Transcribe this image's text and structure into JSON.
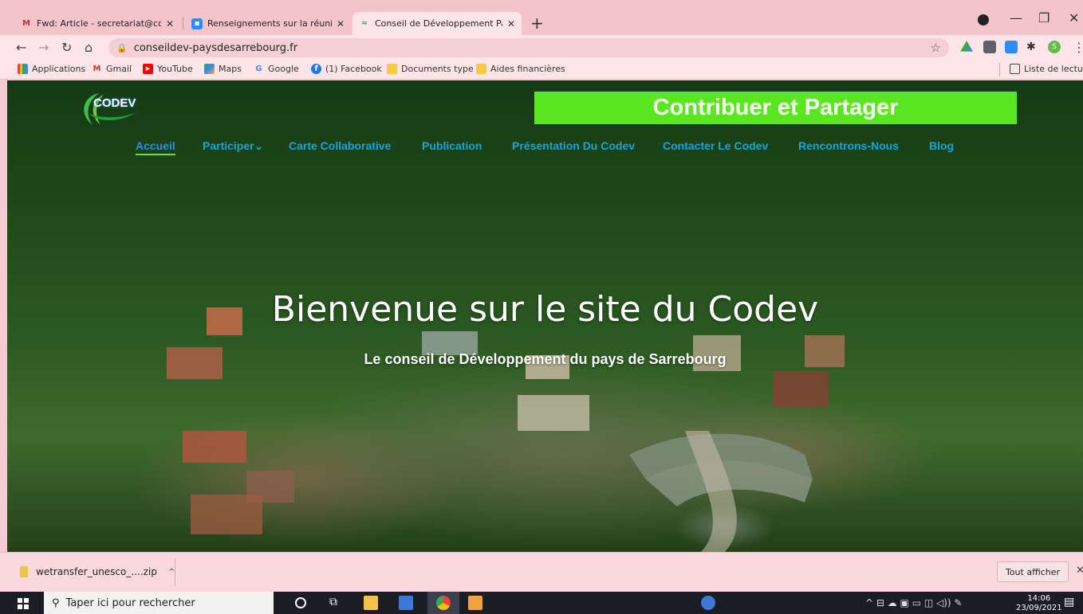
{
  "tabs": [
    {
      "title": "Fwd: Article - secretariat@consei",
      "close": "✕",
      "favicon": "gmail-icon",
      "active": false
    },
    {
      "title": "Renseignements sur la réunion -",
      "close": "✕",
      "favicon": "zoom-icon",
      "active": false
    },
    {
      "title": "Conseil de Développement Pays",
      "close": "✕",
      "favicon": "codev-icon",
      "active": true
    }
  ],
  "newtab_label": "+",
  "window_controls": {
    "minimize": "—",
    "maximize": "❐",
    "close": "✕"
  },
  "address": {
    "url": "conseildev-paysdesarrebourg.fr"
  },
  "bookmarks": [
    {
      "label": "Applications",
      "icon": "apps-grid-icon"
    },
    {
      "label": "Gmail",
      "icon": "gmail-icon"
    },
    {
      "label": "YouTube",
      "icon": "youtube-icon"
    },
    {
      "label": "Maps",
      "icon": "maps-icon"
    },
    {
      "label": "Google",
      "icon": "google-icon"
    },
    {
      "label": "(1) Facebook",
      "icon": "facebook-icon"
    },
    {
      "label": "Documents type",
      "icon": "folder-icon"
    },
    {
      "label": "Aides financières",
      "icon": "folder-icon"
    }
  ],
  "reading_list": "Liste de lecture",
  "site": {
    "logo_text": "CODEV",
    "cta": "Contribuer et Partager",
    "nav": [
      {
        "label": "Accueil",
        "active": true
      },
      {
        "label": "Participer",
        "dropdown": "⌄"
      },
      {
        "label": "Carte Collaborative"
      },
      {
        "label": "Publication"
      },
      {
        "label": "Présentation Du Codev"
      },
      {
        "label": "Contacter Le Codev"
      },
      {
        "label": "Rencontrons-Nous"
      },
      {
        "label": "Blog"
      }
    ],
    "hero_title": "Bienvenue sur le site du Codev",
    "hero_subtitle": "Le conseil de Développement du pays de Sarrebourg"
  },
  "download": {
    "filename": "wetransfer_unesco_....zip",
    "chevron": "^",
    "show_all": "Tout afficher",
    "close": "✕"
  },
  "taskbar": {
    "search_placeholder": "Taper ici pour rechercher",
    "time": "14:06",
    "date": "23/09/2021"
  },
  "colors": {
    "chrome_pink": "#f4c4cb",
    "cta_green": "#5ae71f",
    "nav_blue": "#1aa3d9"
  }
}
